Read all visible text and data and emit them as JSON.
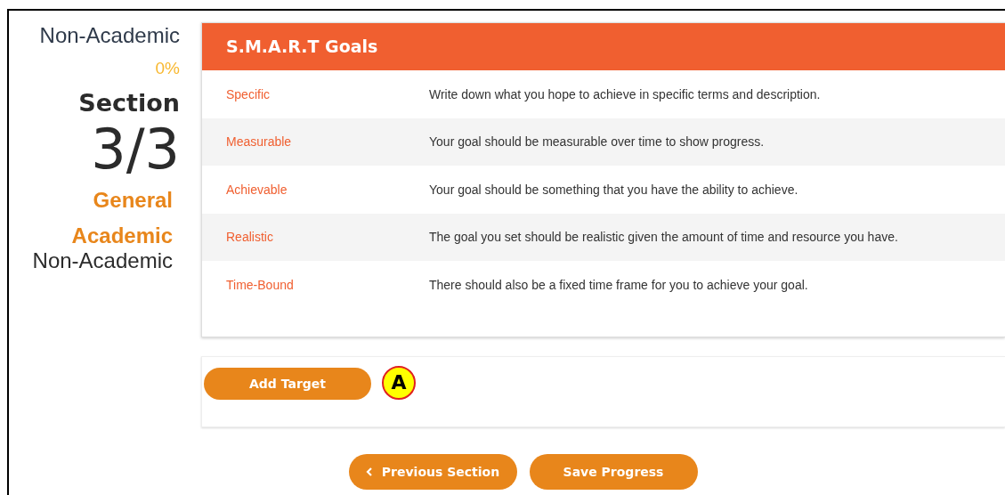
{
  "sidebar": {
    "heading": "Non-Academic",
    "progress": "0%",
    "section_label": "Section",
    "section_count": "3/3",
    "categories": [
      {
        "label": "General",
        "selected": false
      },
      {
        "label": "Academic",
        "selected": false
      },
      {
        "label": "Non-Academic",
        "selected": true
      }
    ]
  },
  "smart_card": {
    "title": "S.M.A.R.T Goals",
    "rows": [
      {
        "term": "Specific",
        "description": "Write down what you hope to achieve in specific terms and description."
      },
      {
        "term": "Measurable",
        "description": "Your goal should be measurable over time to show progress."
      },
      {
        "term": "Achievable",
        "description": "Your goal should be something that you have the ability to achieve."
      },
      {
        "term": "Realistic",
        "description": "The goal you set should be realistic given the amount of time and resource you have."
      },
      {
        "term": "Time-Bound",
        "description": "There should also be a fixed time frame for you to achieve your goal."
      }
    ]
  },
  "add_target_button": "Add Target",
  "callout": "A",
  "footer_buttons": [
    {
      "kind": "back",
      "label": "Previous Section"
    },
    {
      "kind": "plain",
      "label": "Save Progress"
    }
  ]
}
